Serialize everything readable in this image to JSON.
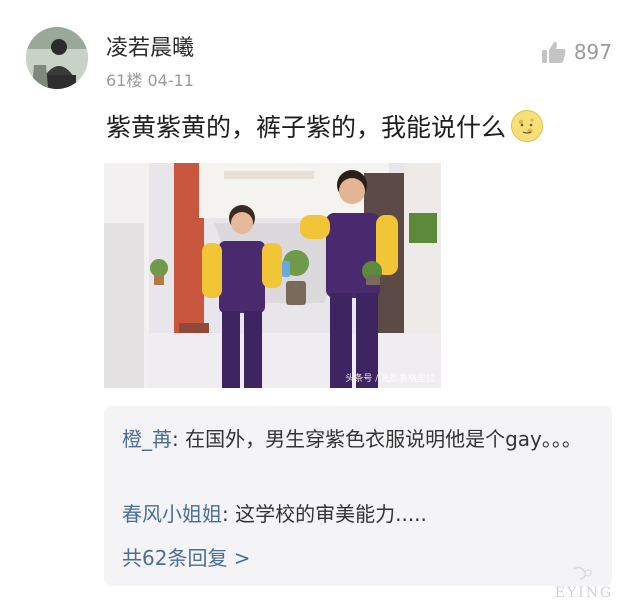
{
  "comment": {
    "username": "凌若晨曦",
    "floor": "61楼",
    "date": "04-11",
    "likes": "897",
    "text": "紫黄紫黄的，裤子紫的，我能说什么"
  },
  "photo": {
    "watermark": "头条号 / 光影香格里拉"
  },
  "replies": [
    {
      "name": "橙_苒",
      "sep": ": ",
      "text": "在国外，男生穿紫色衣服说明他是个gay。。。"
    },
    {
      "name": "春风小姐姐",
      "sep": ": ",
      "text": "这学校的审美能力....."
    }
  ],
  "more_replies": "共62条回复 >",
  "corner_logo": "EYING",
  "colors": {
    "accent": "#4a6d97",
    "meta": "#9a9a9a",
    "reply_bg": "#f4f4f6"
  }
}
